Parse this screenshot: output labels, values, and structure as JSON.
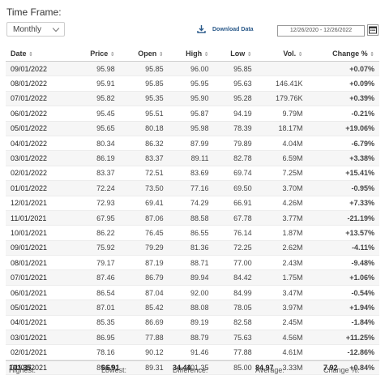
{
  "timeframe": {
    "label": "Time Frame:",
    "selected": "Monthly"
  },
  "download": {
    "label": "Download Data"
  },
  "daterange": {
    "value": "12/26/2020 - 12/26/2022"
  },
  "table": {
    "headers": [
      "Date",
      "Price",
      "Open",
      "High",
      "Low",
      "Vol.",
      "Change %"
    ],
    "rows": [
      {
        "date": "09/01/2022",
        "price": "95.98",
        "open": "95.85",
        "high": "96.00",
        "low": "95.85",
        "vol": "",
        "change": "+0.07%",
        "dir": "up"
      },
      {
        "date": "08/01/2022",
        "price": "95.91",
        "open": "95.85",
        "high": "95.95",
        "low": "95.63",
        "vol": "146.41K",
        "change": "+0.09%",
        "dir": "up"
      },
      {
        "date": "07/01/2022",
        "price": "95.82",
        "open": "95.35",
        "high": "95.90",
        "low": "95.28",
        "vol": "179.76K",
        "change": "+0.39%",
        "dir": "up"
      },
      {
        "date": "06/01/2022",
        "price": "95.45",
        "open": "95.51",
        "high": "95.87",
        "low": "94.19",
        "vol": "9.79M",
        "change": "-0.21%",
        "dir": "down"
      },
      {
        "date": "05/01/2022",
        "price": "95.65",
        "open": "80.18",
        "high": "95.98",
        "low": "78.39",
        "vol": "18.17M",
        "change": "+19.06%",
        "dir": "up"
      },
      {
        "date": "04/01/2022",
        "price": "80.34",
        "open": "86.32",
        "high": "87.99",
        "low": "79.89",
        "vol": "4.04M",
        "change": "-6.79%",
        "dir": "down"
      },
      {
        "date": "03/01/2022",
        "price": "86.19",
        "open": "83.37",
        "high": "89.11",
        "low": "82.78",
        "vol": "6.59M",
        "change": "+3.38%",
        "dir": "up"
      },
      {
        "date": "02/01/2022",
        "price": "83.37",
        "open": "72.51",
        "high": "83.69",
        "low": "69.74",
        "vol": "7.25M",
        "change": "+15.41%",
        "dir": "up"
      },
      {
        "date": "01/01/2022",
        "price": "72.24",
        "open": "73.50",
        "high": "77.16",
        "low": "69.50",
        "vol": "3.70M",
        "change": "-0.95%",
        "dir": "down"
      },
      {
        "date": "12/01/2021",
        "price": "72.93",
        "open": "69.41",
        "high": "74.29",
        "low": "66.91",
        "vol": "4.26M",
        "change": "+7.33%",
        "dir": "up"
      },
      {
        "date": "11/01/2021",
        "price": "67.95",
        "open": "87.06",
        "high": "88.58",
        "low": "67.78",
        "vol": "3.77M",
        "change": "-21.19%",
        "dir": "down"
      },
      {
        "date": "10/01/2021",
        "price": "86.22",
        "open": "76.45",
        "high": "86.55",
        "low": "76.14",
        "vol": "1.87M",
        "change": "+13.57%",
        "dir": "up"
      },
      {
        "date": "09/01/2021",
        "price": "75.92",
        "open": "79.29",
        "high": "81.36",
        "low": "72.25",
        "vol": "2.62M",
        "change": "-4.11%",
        "dir": "down"
      },
      {
        "date": "08/01/2021",
        "price": "79.17",
        "open": "87.19",
        "high": "88.71",
        "low": "77.00",
        "vol": "2.43M",
        "change": "-9.48%",
        "dir": "down"
      },
      {
        "date": "07/01/2021",
        "price": "87.46",
        "open": "86.79",
        "high": "89.94",
        "low": "84.42",
        "vol": "1.75M",
        "change": "+1.06%",
        "dir": "up"
      },
      {
        "date": "06/01/2021",
        "price": "86.54",
        "open": "87.04",
        "high": "92.00",
        "low": "84.99",
        "vol": "3.47M",
        "change": "-0.54%",
        "dir": "down"
      },
      {
        "date": "05/01/2021",
        "price": "87.01",
        "open": "85.42",
        "high": "88.08",
        "low": "78.05",
        "vol": "3.97M",
        "change": "+1.94%",
        "dir": "up"
      },
      {
        "date": "04/01/2021",
        "price": "85.35",
        "open": "86.69",
        "high": "89.19",
        "low": "82.58",
        "vol": "2.45M",
        "change": "-1.84%",
        "dir": "down"
      },
      {
        "date": "03/01/2021",
        "price": "86.95",
        "open": "77.88",
        "high": "88.79",
        "low": "75.63",
        "vol": "4.56M",
        "change": "+11.25%",
        "dir": "up"
      },
      {
        "date": "02/01/2021",
        "price": "78.16",
        "open": "90.12",
        "high": "91.46",
        "low": "77.88",
        "vol": "4.61M",
        "change": "-12.86%",
        "dir": "down"
      },
      {
        "date": "01/01/2021",
        "price": "89.69",
        "open": "89.31",
        "high": "101.35",
        "low": "85.00",
        "vol": "3.33M",
        "change": "+0.84%",
        "dir": "up"
      }
    ]
  },
  "summary": {
    "highest_label": "Highest:",
    "highest": "101.35",
    "lowest_label": "Lowest:",
    "lowest": "66.91",
    "difference_label": "Difference:",
    "difference": "34.44",
    "average_label": "Average:",
    "average": "84.97",
    "change_label": "Change %:",
    "change": "7.92"
  },
  "colors": {
    "up": "#2e9e2e",
    "down": "#e53935",
    "link": "#2b5a8a"
  },
  "icons": {
    "download": "download-icon",
    "calendar": "calendar-icon",
    "select": "chevron-down-icon",
    "sort": "sort-icon"
  }
}
